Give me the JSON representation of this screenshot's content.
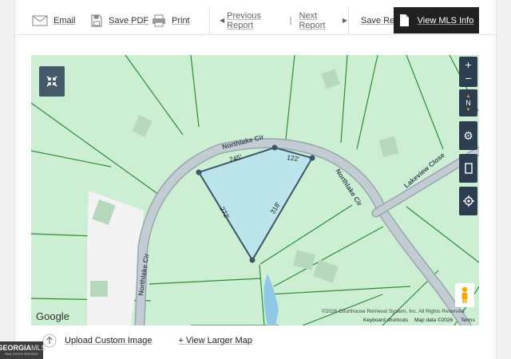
{
  "toolbar": {
    "email_label": "Email",
    "save_pdf_label": "Save PDF",
    "print_label": "Print",
    "prev_label": "Previous Report",
    "divider": "|",
    "next_label": "Next Report",
    "save_report_label": "Save Report",
    "view_mls_label": "View MLS Info"
  },
  "map": {
    "streets": [
      "Northlake Cir",
      "Northlake Cir",
      "Northlake Cir",
      "Lakeview Close"
    ],
    "dimensions": [
      "245'",
      "122'",
      "272'",
      "318'"
    ],
    "zoom_in": "+",
    "zoom_out": "−",
    "compass_label": "N",
    "google_logo": "Google",
    "copyright": "©2026 Courthouse Retrieval System, Inc. All Rights Reserved.",
    "keyboard_shortcuts": "Keyboard shortcuts",
    "map_data": "Map data ©2026",
    "terms": "Terms",
    "colors": {
      "land": "#ccefd3",
      "parcel_lines": "#2e8b3a",
      "road": "#b9c4cc",
      "selected_parcel": "#b9e3ef",
      "water": "#8fc7e6",
      "controls": "#2c3e4f"
    }
  },
  "bottom": {
    "upload_label": "Upload Custom Image",
    "larger_map_label": "+ View Larger Map"
  },
  "brand": {
    "name_georgia": "GEORGIA",
    "name_mls": "MLS",
    "tagline": "REAL ESTATE SERVICES"
  }
}
